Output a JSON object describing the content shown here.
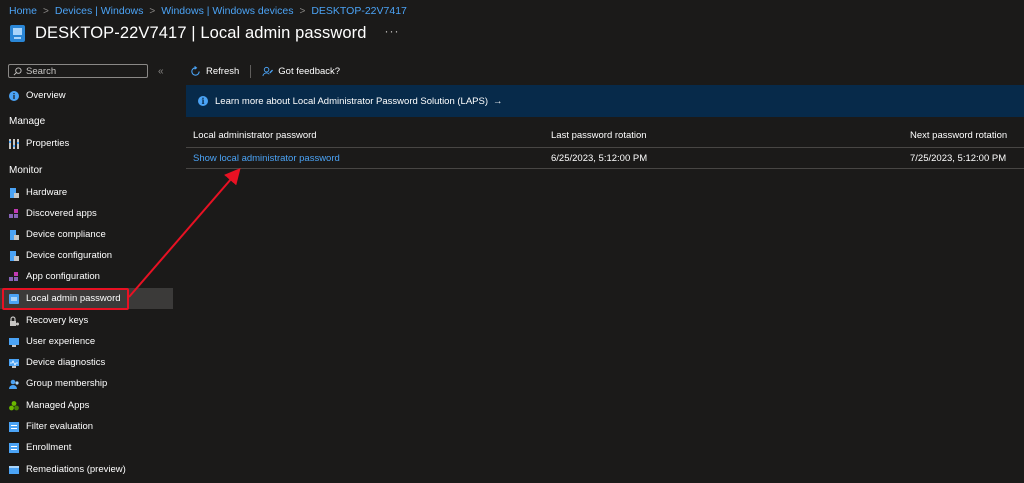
{
  "breadcrumb": [
    "Home",
    "Devices | Windows",
    "Windows | Windows devices",
    "DESKTOP-22V7417"
  ],
  "page": {
    "title": "DESKTOP-22V7417 | Local admin password",
    "more": "···"
  },
  "sidebar": {
    "search_placeholder": "Search",
    "collapse": "«",
    "overview": "Overview",
    "manage_label": "Manage",
    "properties": "Properties",
    "monitor_label": "Monitor",
    "items": [
      "Hardware",
      "Discovered apps",
      "Device compliance",
      "Device configuration",
      "App configuration",
      "Local admin password",
      "Recovery keys",
      "User experience",
      "Device diagnostics",
      "Group membership",
      "Managed Apps",
      "Filter evaluation",
      "Enrollment",
      "Remediations (preview)"
    ],
    "active_item": "Local admin password"
  },
  "toolbar": {
    "refresh": "Refresh",
    "feedback": "Got feedback?"
  },
  "banner": {
    "text": "Learn more about Local Administrator Password Solution (LAPS)",
    "arrow": "→",
    "info": "i"
  },
  "table": {
    "headers": [
      "Local administrator password",
      "Last password rotation",
      "Next password rotation"
    ],
    "rows": [
      {
        "password": "Show local administrator password",
        "last": "6/25/2023, 5:12:00 PM",
        "next": "7/25/2023, 5:12:00 PM"
      }
    ]
  },
  "colors": {
    "accent": "#4ba3f5",
    "highlight": "#e81123",
    "banner": "#072a4a"
  }
}
